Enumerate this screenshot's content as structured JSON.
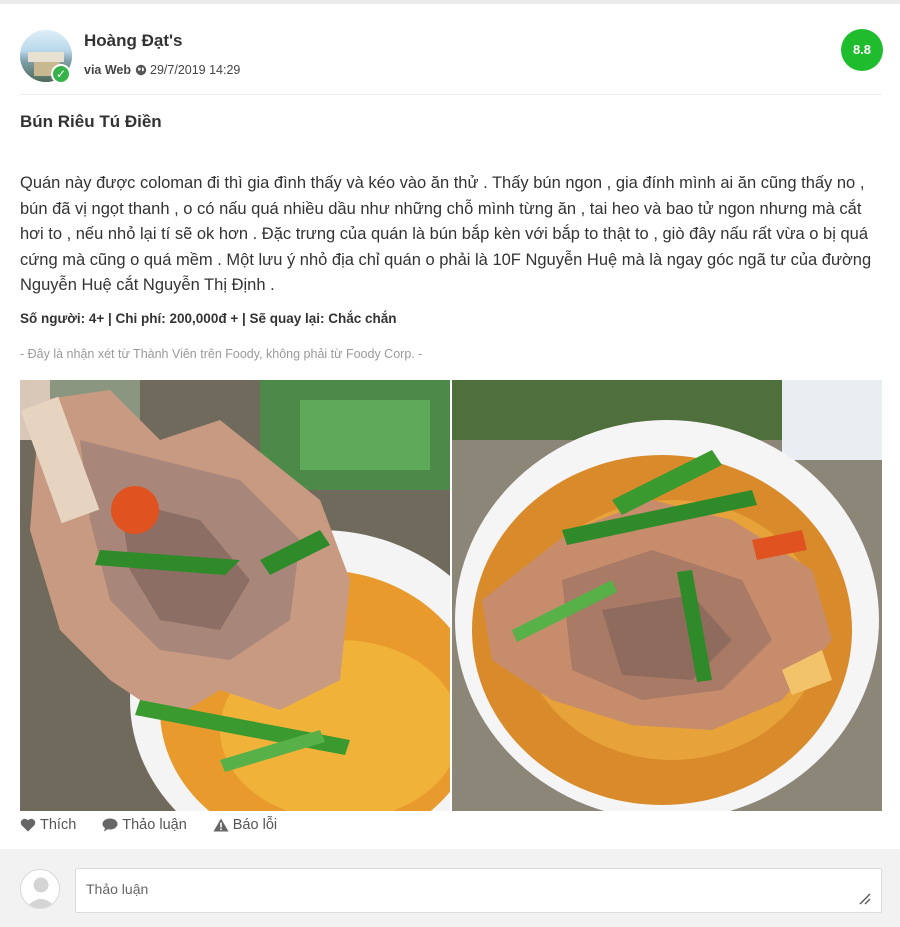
{
  "user": {
    "name": "Hoàng Đạt's",
    "via": "via Web",
    "timestamp": "29/7/2019 14:29"
  },
  "score": "8.8",
  "review": {
    "title": "Bún Riêu Tú Điền",
    "body": "Quán này được coloman đi thì gia đình thấy và kéo vào ăn thử . Thấy bún ngon , gia đính mình ai ăn cũng thấy no , bún đã vị ngọt thanh , o có nấu quá nhiều dầu như những chỗ mình từng ăn , tai heo và bao tử ngon nhưng mà cắt hơi to , nếu nhỏ lại tí sẽ ok hơn . Đặc trưng của quán là bún bắp kèn với bắp to thật to , giò đây nấu rất vừa o bị quá cứng mà cũng o quá mềm . Một lưu ý nhỏ địa chỉ quán o phải là 10F Nguyễn Huệ mà là ngay góc ngã tư của đường Nguyễn Huệ cắt Nguyễn Thị Định .",
    "stats": "Số người: 4+ | Chi phí: 200,000đ + | Sẽ quay lại: Chắc chắn",
    "disclaimer": "- Đây là nhận xét từ Thành Viên trên Foody, không phải từ Foody Corp. -"
  },
  "actions": {
    "like": "Thích",
    "discuss": "Thảo luận",
    "report": "Báo lỗi"
  },
  "comment": {
    "placeholder": "Thảo luận"
  },
  "colors": {
    "score_badge": "#1fbd2e",
    "verified_badge": "#35b24a"
  },
  "icons": [
    "globe-icon",
    "verified-check-icon",
    "heart-icon",
    "comment-bubble-icon",
    "warning-icon",
    "resize-grip-icon",
    "user-placeholder-icon"
  ]
}
